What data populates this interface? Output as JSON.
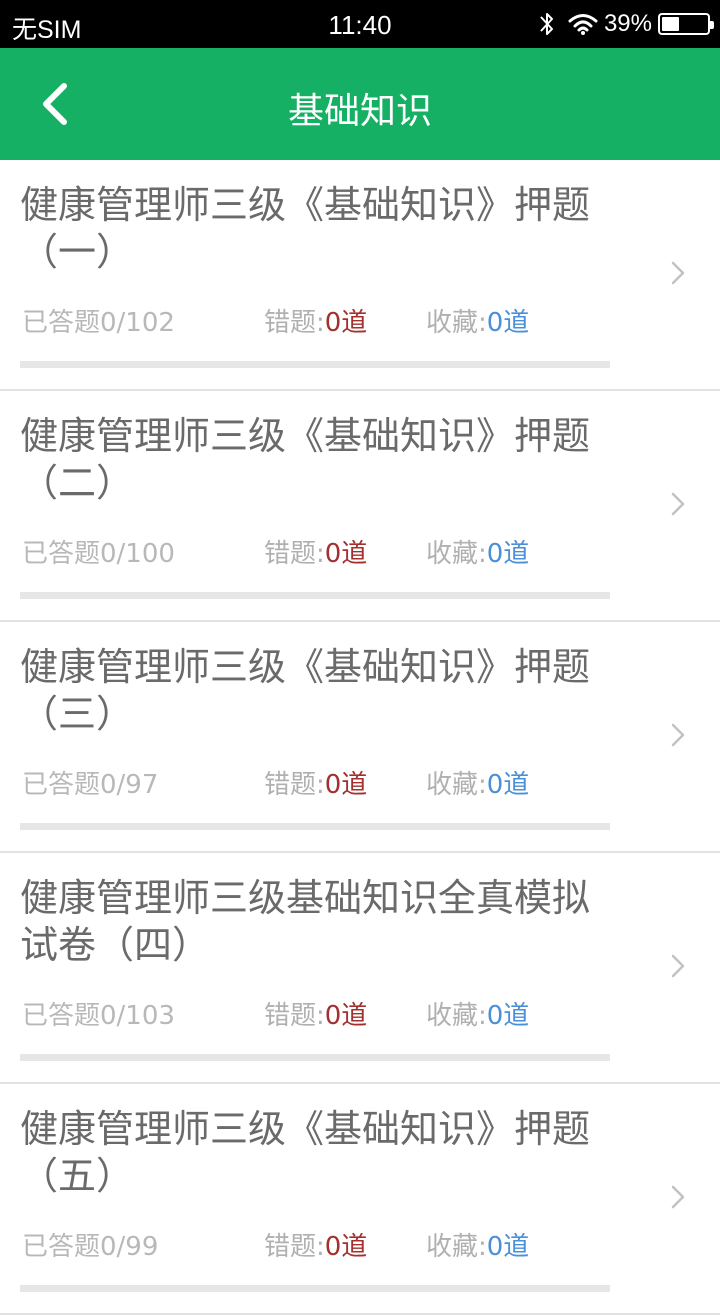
{
  "status_bar": {
    "carrier": "无SIM",
    "time": "11:40",
    "battery": "39%",
    "battery_level": 0.39
  },
  "header": {
    "title": "基础知识"
  },
  "items": [
    {
      "title": "健康管理师三级《基础知识》押题（一）",
      "answered_label": "已答题0/102",
      "wrong_label": "错题:",
      "wrong_value": "0道",
      "fav_label": "收藏:",
      "fav_value": "0道",
      "progress": 0
    },
    {
      "title": "健康管理师三级《基础知识》押题（二）",
      "answered_label": "已答题0/100",
      "wrong_label": "错题:",
      "wrong_value": "0道",
      "fav_label": "收藏:",
      "fav_value": "0道",
      "progress": 0
    },
    {
      "title": "健康管理师三级《基础知识》押题（三）",
      "answered_label": "已答题0/97",
      "wrong_label": "错题:",
      "wrong_value": "0道",
      "fav_label": "收藏:",
      "fav_value": "0道",
      "progress": 0
    },
    {
      "title": "健康管理师三级基础知识全真模拟试卷（四）",
      "answered_label": "已答题0/103",
      "wrong_label": "错题:",
      "wrong_value": "0道",
      "fav_label": "收藏:",
      "fav_value": "0道",
      "progress": 0
    },
    {
      "title": "健康管理师三级《基础知识》押题（五）",
      "answered_label": "已答题0/99",
      "wrong_label": "错题:",
      "wrong_value": "0道",
      "fav_label": "收藏:",
      "fav_value": "0道",
      "progress": 0
    }
  ],
  "colors": {
    "header_bg": "#15b063",
    "wrong_value": "#a3302e",
    "fav_value": "#4a90d9",
    "title_text": "#6a6a6a",
    "muted_text": "#b8b8b8"
  },
  "icons": {
    "back": "chevron-left-icon",
    "item_arrow": "chevron-right-icon",
    "bluetooth": "bluetooth-icon",
    "wifi": "wifi-icon",
    "battery": "battery-icon"
  }
}
